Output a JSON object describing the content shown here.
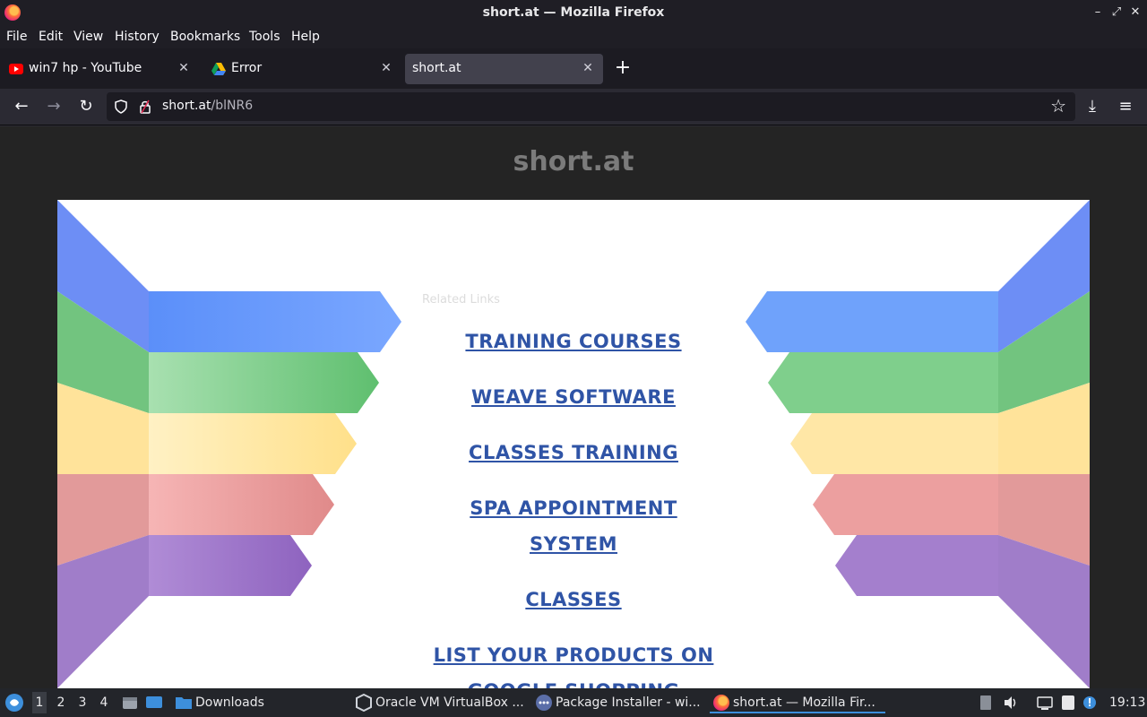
{
  "window": {
    "title": "short.at — Mozilla Firefox"
  },
  "menu": [
    "File",
    "Edit",
    "View",
    "History",
    "Bookmarks",
    "Tools",
    "Help"
  ],
  "tabs": [
    {
      "title": "win7 hp - YouTube",
      "icon": "youtube-icon"
    },
    {
      "title": "Error",
      "icon": "google-drive-icon"
    },
    {
      "title": "short.at",
      "icon": ""
    }
  ],
  "urlbar": {
    "domain": "short.at",
    "path": "/blNR6"
  },
  "page": {
    "site_title": "short.at",
    "related_label": "Related Links",
    "links": [
      "TRAINING COURSES",
      "WEAVE SOFTWARE",
      "CLASSES TRAINING",
      "SPA APPOINTMENT SYSTEM",
      "CLASSES",
      "LIST YOUR PRODUCTS ON GOOGLE SHOPPING"
    ]
  },
  "taskbar": {
    "workspaces": [
      "1",
      "2",
      "3",
      "4"
    ],
    "downloads_label": "Downloads",
    "tasks": [
      "Oracle VM VirtualBox ...",
      "Package Installer - wi...",
      "short.at — Mozilla Fir..."
    ],
    "clock": "19:13"
  },
  "colors": {
    "link": "#2f54a6",
    "blue": "#5b8ff9",
    "green": "#6cc77a",
    "yellow": "#ffe08a",
    "red": "#e88c8c",
    "purple": "#9b73c4"
  }
}
